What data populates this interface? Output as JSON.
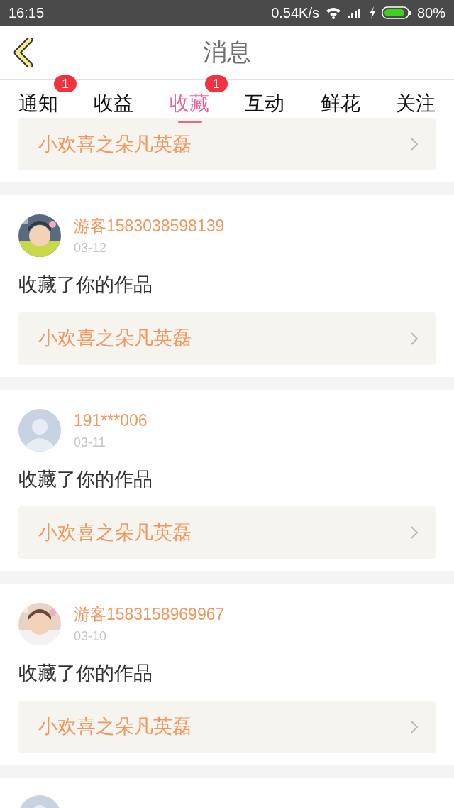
{
  "status_bar": {
    "time": "16:15",
    "speed": "0.54K/s",
    "battery": "80%"
  },
  "header": {
    "title": "消息"
  },
  "tabs": [
    {
      "label": "通知",
      "selected": false,
      "badge": "1"
    },
    {
      "label": "收益",
      "selected": false
    },
    {
      "label": "收藏",
      "selected": true,
      "badge": "1"
    },
    {
      "label": "互动",
      "selected": false
    },
    {
      "label": "鲜花",
      "selected": false
    },
    {
      "label": "关注",
      "selected": false
    }
  ],
  "top_card": {
    "work": "小欢喜之朵凡英磊"
  },
  "items": [
    {
      "name": "游客1583038598139",
      "date": "03-12",
      "action": "收藏了你的作品",
      "work": "小欢喜之朵凡英磊"
    },
    {
      "avatar": {
        "kind": "default"
      },
      "name": "191***006",
      "date": "03-11",
      "action": "收藏了你的作品",
      "work": "小欢喜之朵凡英磊"
    },
    {
      "name": "游客1583158969967",
      "date": "03-10",
      "action": "收藏了你的作品",
      "work": "小欢喜之朵凡英磊"
    }
  ],
  "cut_item": {
    "avatar": {
      "kind": "default"
    }
  }
}
